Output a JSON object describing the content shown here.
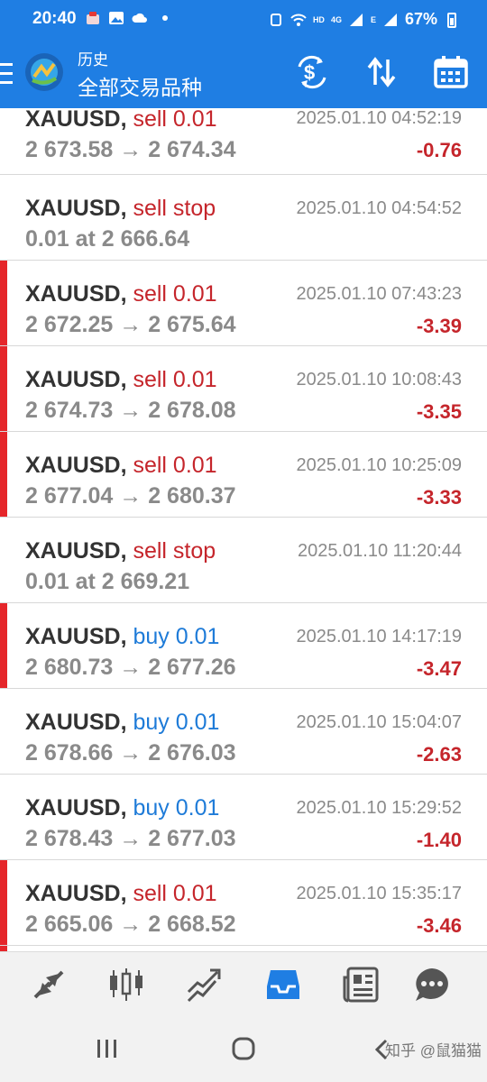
{
  "status_bar": {
    "time": "20:40",
    "battery": "67%",
    "network_labels": [
      "HD",
      "4G",
      "E"
    ]
  },
  "header": {
    "subtitle": "历史",
    "title": "全部交易品种",
    "icons": [
      "menu-icon",
      "app-logo",
      "currency-exchange-icon",
      "sort-icon",
      "calendar-icon"
    ]
  },
  "colors": {
    "accent": "#1f7ee3",
    "sell": "#c5252b",
    "buy": "#1e7bd8",
    "loss_bar": "#e5262a"
  },
  "trades": [
    {
      "symbol": "XAUUSD,",
      "type": "sell 0.01",
      "side": "sell",
      "prices": "2 673.58 → 2 674.34",
      "time": "2025.01.10 04:52:19",
      "profit": "-0.76",
      "bar": false
    },
    {
      "symbol": "XAUUSD,",
      "type": "sell stop",
      "side": "sell",
      "prices": "0.01 at 2 666.64",
      "time": "2025.01.10 04:54:52",
      "profit": "",
      "bar": false
    },
    {
      "symbol": "XAUUSD,",
      "type": "sell 0.01",
      "side": "sell",
      "prices": "2 672.25 → 2 675.64",
      "time": "2025.01.10 07:43:23",
      "profit": "-3.39",
      "bar": true
    },
    {
      "symbol": "XAUUSD,",
      "type": "sell 0.01",
      "side": "sell",
      "prices": "2 674.73 → 2 678.08",
      "time": "2025.01.10 10:08:43",
      "profit": "-3.35",
      "bar": true
    },
    {
      "symbol": "XAUUSD,",
      "type": "sell 0.01",
      "side": "sell",
      "prices": "2 677.04 → 2 680.37",
      "time": "2025.01.10 10:25:09",
      "profit": "-3.33",
      "bar": true
    },
    {
      "symbol": "XAUUSD,",
      "type": "sell stop",
      "side": "sell",
      "prices": "0.01 at 2 669.21",
      "time": "2025.01.10 11:20:44",
      "profit": "",
      "bar": false
    },
    {
      "symbol": "XAUUSD,",
      "type": "buy 0.01",
      "side": "buy",
      "prices": "2 680.73 → 2 677.26",
      "time": "2025.01.10 14:17:19",
      "profit": "-3.47",
      "bar": true
    },
    {
      "symbol": "XAUUSD,",
      "type": "buy 0.01",
      "side": "buy",
      "prices": "2 678.66 → 2 676.03",
      "time": "2025.01.10 15:04:07",
      "profit": "-2.63",
      "bar": false
    },
    {
      "symbol": "XAUUSD,",
      "type": "buy 0.01",
      "side": "buy",
      "prices": "2 678.43 → 2 677.03",
      "time": "2025.01.10 15:29:52",
      "profit": "-1.40",
      "bar": false
    },
    {
      "symbol": "XAUUSD,",
      "type": "sell 0.01",
      "side": "sell",
      "prices": "2 665.06 → 2 668.52",
      "time": "2025.01.10 15:35:17",
      "profit": "-3.46",
      "bar": true
    }
  ],
  "bottom_tabs": [
    {
      "icon": "quotes-arrows-icon",
      "active": false
    },
    {
      "icon": "candlestick-chart-icon",
      "active": false
    },
    {
      "icon": "trade-trend-icon",
      "active": false
    },
    {
      "icon": "history-inbox-icon",
      "active": true
    },
    {
      "icon": "news-icon",
      "active": false
    },
    {
      "icon": "chat-icon",
      "active": false
    }
  ],
  "watermark": "知乎 @鼠猫猫"
}
